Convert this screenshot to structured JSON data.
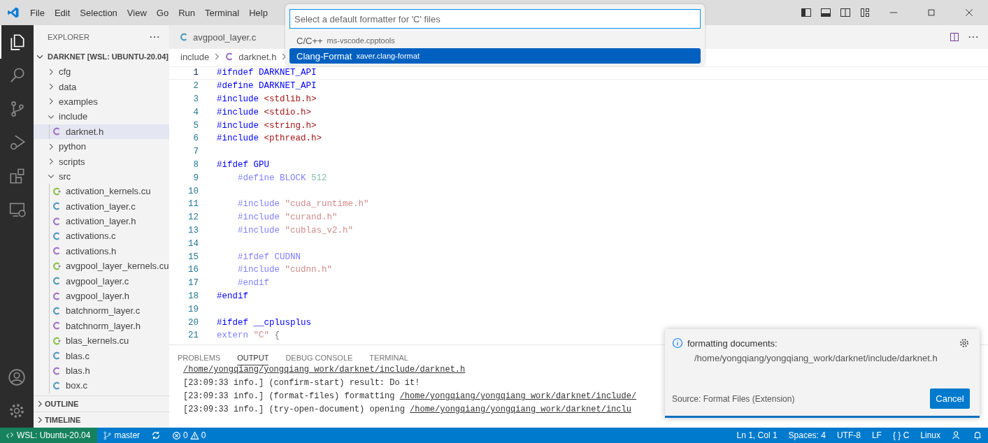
{
  "menu": [
    "File",
    "Edit",
    "Selection",
    "View",
    "Go",
    "Run",
    "Terminal",
    "Help"
  ],
  "activity_bar": [
    {
      "kind": "explorer",
      "selected": true
    },
    {
      "kind": "search",
      "selected": false
    },
    {
      "kind": "source-control",
      "selected": false
    },
    {
      "kind": "run",
      "selected": false
    },
    {
      "kind": "extensions",
      "selected": false
    },
    {
      "kind": "remote",
      "selected": false
    }
  ],
  "sidebar": {
    "title": "EXPLORER",
    "root": "DARKNET [WSL: UBUNTU-20.04]",
    "tree": [
      {
        "label": "cfg",
        "kind": "folder",
        "expanded": false,
        "selected": false
      },
      {
        "label": "data",
        "kind": "folder",
        "expanded": false,
        "selected": false
      },
      {
        "label": "examples",
        "kind": "folder",
        "expanded": false,
        "selected": false
      },
      {
        "label": "include",
        "kind": "folder",
        "expanded": true,
        "selected": false,
        "children": [
          {
            "label": "darknet.h",
            "kind": "h",
            "selected": true
          }
        ]
      },
      {
        "label": "python",
        "kind": "folder",
        "expanded": false,
        "selected": false
      },
      {
        "label": "scripts",
        "kind": "folder",
        "expanded": false,
        "selected": false
      },
      {
        "label": "src",
        "kind": "folder",
        "expanded": true,
        "selected": false,
        "children": [
          {
            "label": "activation_kernels.cu",
            "kind": "cu",
            "selected": false
          },
          {
            "label": "activation_layer.c",
            "kind": "c",
            "selected": false
          },
          {
            "label": "activation_layer.h",
            "kind": "h",
            "selected": false
          },
          {
            "label": "activations.c",
            "kind": "c",
            "selected": false
          },
          {
            "label": "activations.h",
            "kind": "h",
            "selected": false
          },
          {
            "label": "avgpool_layer_kernels.cu",
            "kind": "cu",
            "selected": false
          },
          {
            "label": "avgpool_layer.c",
            "kind": "c",
            "selected": false
          },
          {
            "label": "avgpool_layer.h",
            "kind": "h",
            "selected": false
          },
          {
            "label": "batchnorm_layer.c",
            "kind": "c",
            "selected": false
          },
          {
            "label": "batchnorm_layer.h",
            "kind": "h",
            "selected": false
          },
          {
            "label": "blas_kernels.cu",
            "kind": "cu",
            "selected": false
          },
          {
            "label": "blas.c",
            "kind": "c",
            "selected": false
          },
          {
            "label": "blas.h",
            "kind": "h",
            "selected": false
          },
          {
            "label": "box.c",
            "kind": "c",
            "selected": false
          }
        ]
      }
    ],
    "sections": [
      "OUTLINE",
      "TIMELINE"
    ]
  },
  "tabs": [
    {
      "label": "avgpool_layer.c",
      "kind": "c",
      "selected": false
    }
  ],
  "breadcrumbs": [
    "include",
    "darknet.h"
  ],
  "code": [
    {
      "number": "1",
      "inactive": false,
      "tokens": [
        {
          "text": "#ifndef ",
          "kind": "keyword"
        },
        {
          "text": "DARKNET_API",
          "kind": "macro"
        }
      ]
    },
    {
      "number": "2",
      "inactive": false,
      "tokens": [
        {
          "text": "#define ",
          "kind": "keyword"
        },
        {
          "text": "DARKNET_API",
          "kind": "macro"
        }
      ]
    },
    {
      "number": "3",
      "inactive": false,
      "tokens": [
        {
          "text": "#include ",
          "kind": "keyword"
        },
        {
          "text": "<stdlib.h>",
          "kind": "string"
        }
      ]
    },
    {
      "number": "4",
      "inactive": false,
      "tokens": [
        {
          "text": "#include ",
          "kind": "keyword"
        },
        {
          "text": "<stdio.h>",
          "kind": "string"
        }
      ]
    },
    {
      "number": "5",
      "inactive": false,
      "tokens": [
        {
          "text": "#include ",
          "kind": "keyword"
        },
        {
          "text": "<string.h>",
          "kind": "string"
        }
      ]
    },
    {
      "number": "6",
      "inactive": false,
      "tokens": [
        {
          "text": "#include ",
          "kind": "keyword"
        },
        {
          "text": "<pthread.h>",
          "kind": "string"
        }
      ]
    },
    {
      "number": "7"
    },
    {
      "number": "8",
      "inactive": false,
      "tokens": [
        {
          "text": "#ifdef ",
          "kind": "keyword"
        },
        {
          "text": "GPU",
          "kind": "macro"
        }
      ]
    },
    {
      "number": "9",
      "inactive": true,
      "tokens": [
        {
          "text": "    #define ",
          "kind": "keyword"
        },
        {
          "text": "BLOCK ",
          "kind": "macro"
        },
        {
          "text": "512",
          "kind": "number"
        }
      ]
    },
    {
      "number": "10"
    },
    {
      "number": "11",
      "inactive": true,
      "tokens": [
        {
          "text": "    #include ",
          "kind": "keyword"
        },
        {
          "text": "\"cuda_runtime.h\"",
          "kind": "string"
        }
      ]
    },
    {
      "number": "12",
      "inactive": true,
      "tokens": [
        {
          "text": "    #include ",
          "kind": "keyword"
        },
        {
          "text": "\"curand.h\"",
          "kind": "string"
        }
      ]
    },
    {
      "number": "13",
      "inactive": true,
      "tokens": [
        {
          "text": "    #include ",
          "kind": "keyword"
        },
        {
          "text": "\"cublas_v2.h\"",
          "kind": "string"
        }
      ]
    },
    {
      "number": "14"
    },
    {
      "number": "15",
      "inactive": true,
      "tokens": [
        {
          "text": "    #ifdef ",
          "kind": "keyword"
        },
        {
          "text": "CUDNN",
          "kind": "macro"
        }
      ]
    },
    {
      "number": "16",
      "inactive": true,
      "tokens": [
        {
          "text": "    #include ",
          "kind": "keyword"
        },
        {
          "text": "\"cudnn.h\"",
          "kind": "string"
        }
      ]
    },
    {
      "number": "17",
      "inactive": true,
      "tokens": [
        {
          "text": "    #endif",
          "kind": "keyword"
        }
      ]
    },
    {
      "number": "18",
      "inactive": false,
      "tokens": [
        {
          "text": "#endif",
          "kind": "keyword"
        }
      ]
    },
    {
      "number": "19"
    },
    {
      "number": "20",
      "inactive": false,
      "tokens": [
        {
          "text": "#ifdef ",
          "kind": "keyword"
        },
        {
          "text": "__cplusplus",
          "kind": "macro"
        }
      ]
    },
    {
      "number": "21",
      "inactive": true,
      "tokens": [
        {
          "text": "extern ",
          "kind": "keyword"
        },
        {
          "text": "\"C\" ",
          "kind": "string"
        },
        {
          "text": "{",
          "kind": "plain"
        }
      ]
    }
  ],
  "panel": {
    "tabs": [
      {
        "label": "PROBLEMS",
        "selected": false
      },
      {
        "label": "OUTPUT",
        "selected": true
      },
      {
        "label": "DEBUG CONSOLE",
        "selected": false
      },
      {
        "label": "TERMINAL",
        "selected": false
      }
    ],
    "output": [
      [
        {
          "text": "/home/yongqiang/yongqiang_work/darknet/include/darknet.h",
          "kind": "link"
        }
      ],
      [
        {
          "text": "[23:09:33 info.] (confirm-start) result: Do it!",
          "kind": "plain"
        }
      ],
      [
        {
          "text": "[23:09:33 info.] (format-files) formatting ",
          "kind": "plain"
        },
        {
          "text": "/home/yongqiang/yongqiang_work/darknet/include/",
          "kind": "link"
        }
      ],
      [
        {
          "text": "[23:09:33 info.] (try-open-document) opening ",
          "kind": "plain"
        },
        {
          "text": "/home/yongqiang/yongqiang_work/darknet/inclu",
          "kind": "link"
        }
      ]
    ]
  },
  "quick_pick": {
    "placeholder": "Select a default formatter for 'C' files",
    "items": [
      {
        "label": "C/C++",
        "description": "ms-vscode.cpptools",
        "selected": false
      },
      {
        "label": "Clang-Format",
        "description": "xaver.clang-format",
        "selected": true
      }
    ]
  },
  "notification": {
    "message": "formatting documents:",
    "detail": "/home/yongqiang/yongqiang_work/darknet/include/darknet.h",
    "source": "Source: Format Files (Extension)",
    "button": "Cancel"
  },
  "status_bar": {
    "remote": "WSL: Ubuntu-20.04",
    "branch": "master",
    "errors": "0",
    "warnings": "0",
    "right": [
      "Ln 1, Col 1",
      "Spaces: 4",
      "UTF-8",
      "LF",
      "{ } C",
      "Linux"
    ]
  }
}
